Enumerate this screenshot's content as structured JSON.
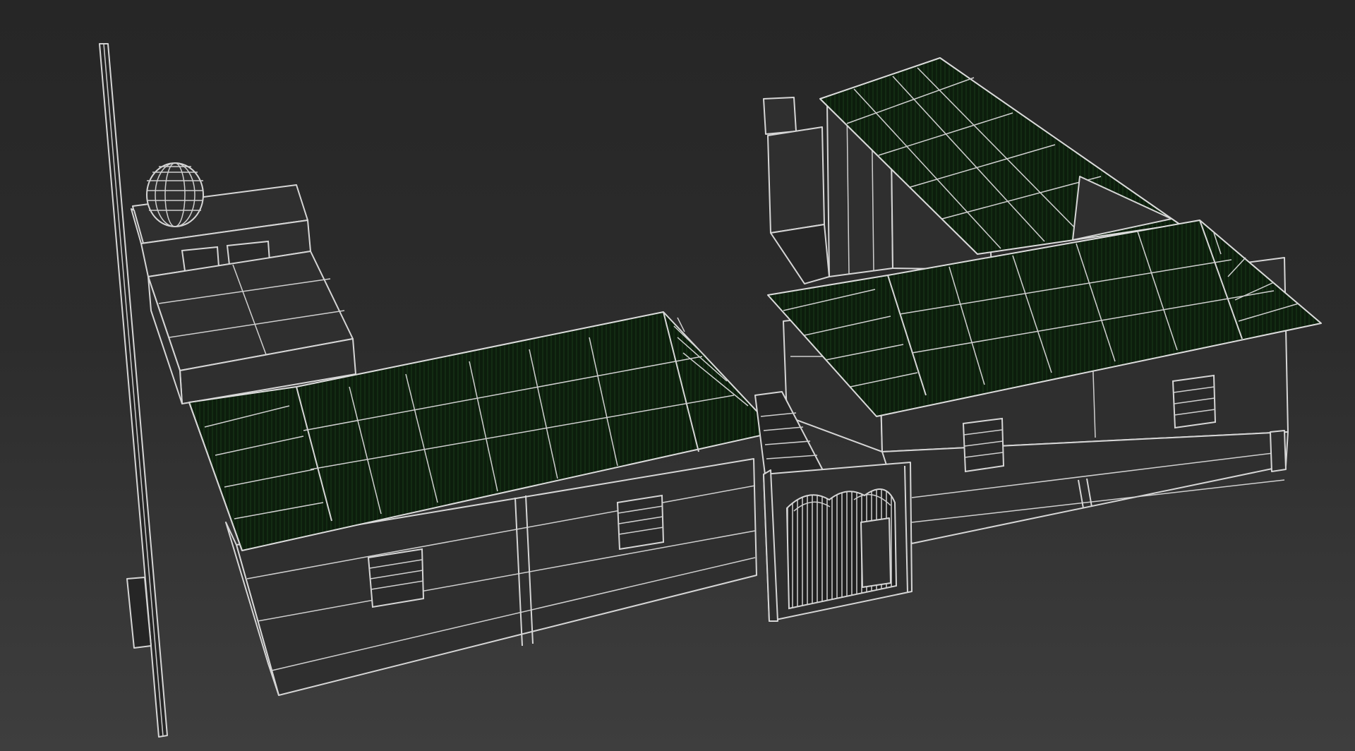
{
  "viewport": {
    "background_top": "#262626",
    "background_bottom": "#3e3e3e",
    "wire_color": "#d6d6d6",
    "roof_fill_color": "#0c1a0c"
  },
  "scene": {
    "objects": [
      "utility-pole",
      "water-tank",
      "upper-rooftop-room",
      "left-hip-roof-building",
      "right-back-gable-building",
      "right-front-hip-roof-building",
      "chimney",
      "front-gate"
    ]
  }
}
